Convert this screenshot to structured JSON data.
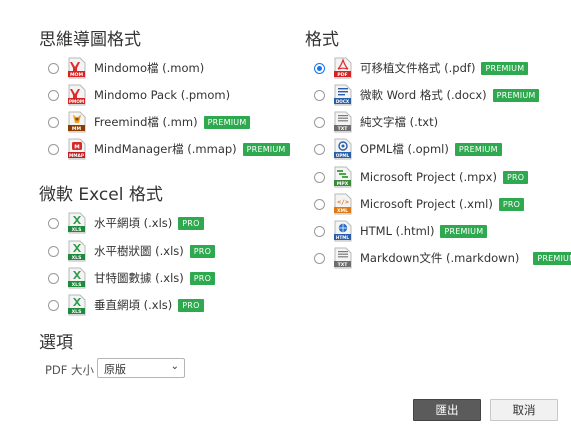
{
  "mindmap_section": {
    "title": "思維導圖格式",
    "options": [
      {
        "label": "Mindomo檔 (.mom)",
        "icon": "mom-file-icon",
        "badge": ""
      },
      {
        "label": "Mindomo Pack (.pmom)",
        "icon": "pmom-file-icon",
        "badge": ""
      },
      {
        "label": "Freemind檔 (.mm)",
        "icon": "mm-file-icon",
        "badge": "PREMIUM"
      },
      {
        "label": "MindManager檔 (.mmap)",
        "icon": "mmap-file-icon",
        "badge": "PREMIUM"
      }
    ]
  },
  "excel_section": {
    "title": "微軟 Excel 格式",
    "options": [
      {
        "label": "水平網頃 (.xls)",
        "icon": "xls-file-icon",
        "badge": "PRO"
      },
      {
        "label": "水平樹狀圖 (.xls)",
        "icon": "xls-file-icon",
        "badge": "PRO"
      },
      {
        "label": "甘特圖數據 (.xls)",
        "icon": "xls-file-icon",
        "badge": "PRO"
      },
      {
        "label": "垂直網頃 (.xls)",
        "icon": "xls-file-icon",
        "badge": "PRO"
      }
    ]
  },
  "format_section": {
    "title": "格式",
    "selected_index": 0,
    "options": [
      {
        "label": "可移植文件格式 (.pdf)",
        "icon": "pdf-file-icon",
        "badge": "PREMIUM"
      },
      {
        "label": "微軟 Word 格式 (.docx)",
        "icon": "docx-file-icon",
        "badge": "PREMIUM"
      },
      {
        "label": "純文字檔 (.txt)",
        "icon": "txt-file-icon",
        "badge": ""
      },
      {
        "label": "OPML檔 (.opml)",
        "icon": "opml-file-icon",
        "badge": "PREMIUM"
      },
      {
        "label": "Microsoft Project (.mpx)",
        "icon": "mpx-file-icon",
        "badge": "PRO"
      },
      {
        "label": "Microsoft Project (.xml)",
        "icon": "xml-file-icon",
        "badge": "PRO"
      },
      {
        "label": "HTML (.html)",
        "icon": "html-file-icon",
        "badge": "PREMIUM"
      },
      {
        "label": "Markdown文件 (.markdown)",
        "icon": "markdown-file-icon",
        "badge": "PREMIUM"
      }
    ]
  },
  "options_section": {
    "title": "選項",
    "pdf_size_label": "PDF 大小",
    "pdf_size_value": "原版"
  },
  "buttons": {
    "export": "匯出",
    "cancel": "取消"
  },
  "colors": {
    "badge_green": "#2fa94f",
    "radio_selected": "#1a73e8",
    "export_button": "#5b5b5b"
  }
}
